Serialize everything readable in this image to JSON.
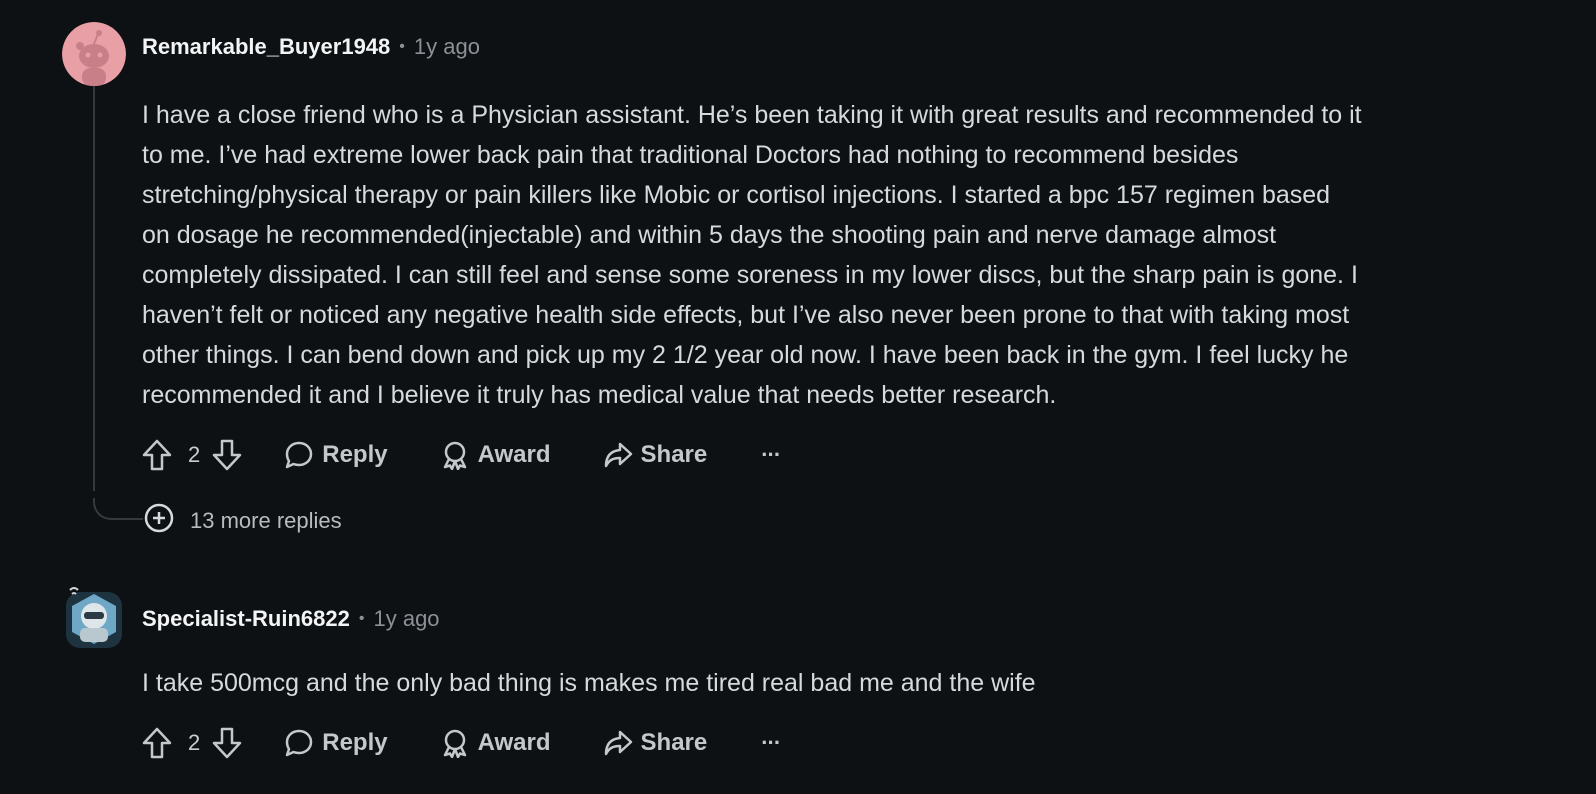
{
  "comments": [
    {
      "username": "Remarkable_Buyer1948",
      "separator": "•",
      "time": "1y ago",
      "lines": [
        "I have a close friend who is a Physician assistant. He’s been taking it with great results and recommended to it",
        "to me. I’ve had extreme lower back pain that traditional Doctors had nothing to recommend besides",
        "stretching/physical therapy or pain killers like Mobic or cortisol injections. I started a bpc 157 regimen based",
        "on dosage he recommended(injectable) and within 5 days the shooting pain and nerve damage almost",
        "completely dissipated. I can still feel and sense some soreness in my lower discs, but the sharp pain is gone. I",
        "haven’t felt or noticed any negative health side effects, but I’ve also never been prone to that with taking most",
        "other things. I can bend down and pick up my 2 1/2 year old now. I have been back in the gym. I feel lucky he",
        "recommended it and I believe it truly has medical value that needs better research."
      ],
      "score": "2",
      "reply_label": "Reply",
      "award_label": "Award",
      "share_label": "Share",
      "more_label": "···",
      "more_replies": "13 more replies",
      "avatar_color": "#e8a0a6"
    },
    {
      "username": "Specialist-Ruin6822",
      "separator": "•",
      "time": "1y ago",
      "lines": [
        "I take 500mcg and the only bad thing is makes me tired real bad me and the wife"
      ],
      "score": "2",
      "reply_label": "Reply",
      "award_label": "Award",
      "share_label": "Share",
      "more_label": "···",
      "avatar_color": "#6fa8c7"
    }
  ],
  "colors": {
    "background": "#0e1113",
    "text": "#d7dadc",
    "muted": "#8b9196",
    "thread_line": "#33393d"
  },
  "icons": [
    "upvote-icon",
    "downvote-icon",
    "reply-icon",
    "award-icon",
    "share-icon",
    "overflow-icon",
    "expand-icon"
  ]
}
